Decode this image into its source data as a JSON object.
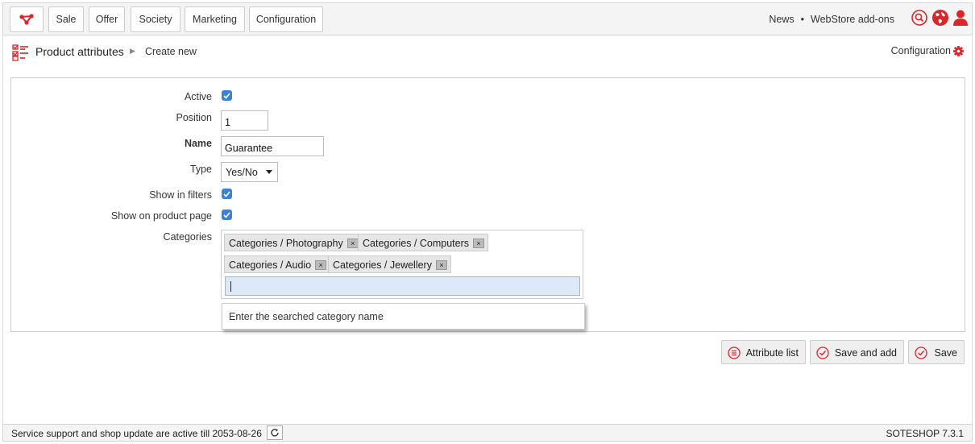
{
  "nav": {
    "items": [
      "Sale",
      "Offer",
      "Society",
      "Marketing",
      "Configuration"
    ],
    "links": [
      "News",
      "WebStore add-ons"
    ],
    "separator": "•"
  },
  "header": {
    "title": "Product attributes",
    "subtitle": "Create new",
    "config_label": "Configuration"
  },
  "form": {
    "active_label": "Active",
    "active_checked": true,
    "position_label": "Position",
    "position_value": "1",
    "name_label": "Name",
    "name_value": "Guarantee",
    "type_label": "Type",
    "type_value": "Yes/No",
    "show_filters_label": "Show in filters",
    "show_filters_checked": true,
    "show_product_label": "Show on product page",
    "show_product_checked": true,
    "categories_label": "Categories",
    "categories": [
      "Categories / Photography",
      "Categories / Computers",
      "Categories / Audio",
      "Categories / Jewellery"
    ],
    "tag_remove": "×",
    "dropdown_hint": "Enter the searched category name"
  },
  "actions": {
    "list_label": "Attribute list",
    "save_add_label": "Save and add",
    "save_label": "Save"
  },
  "footer": {
    "support_text": "Service support and shop update are active till 2053-08-26",
    "version": "SOTESHOP 7.3.1"
  },
  "colors": {
    "accent_red": "#d9262c",
    "checkbox_blue": "#3b82d6"
  }
}
